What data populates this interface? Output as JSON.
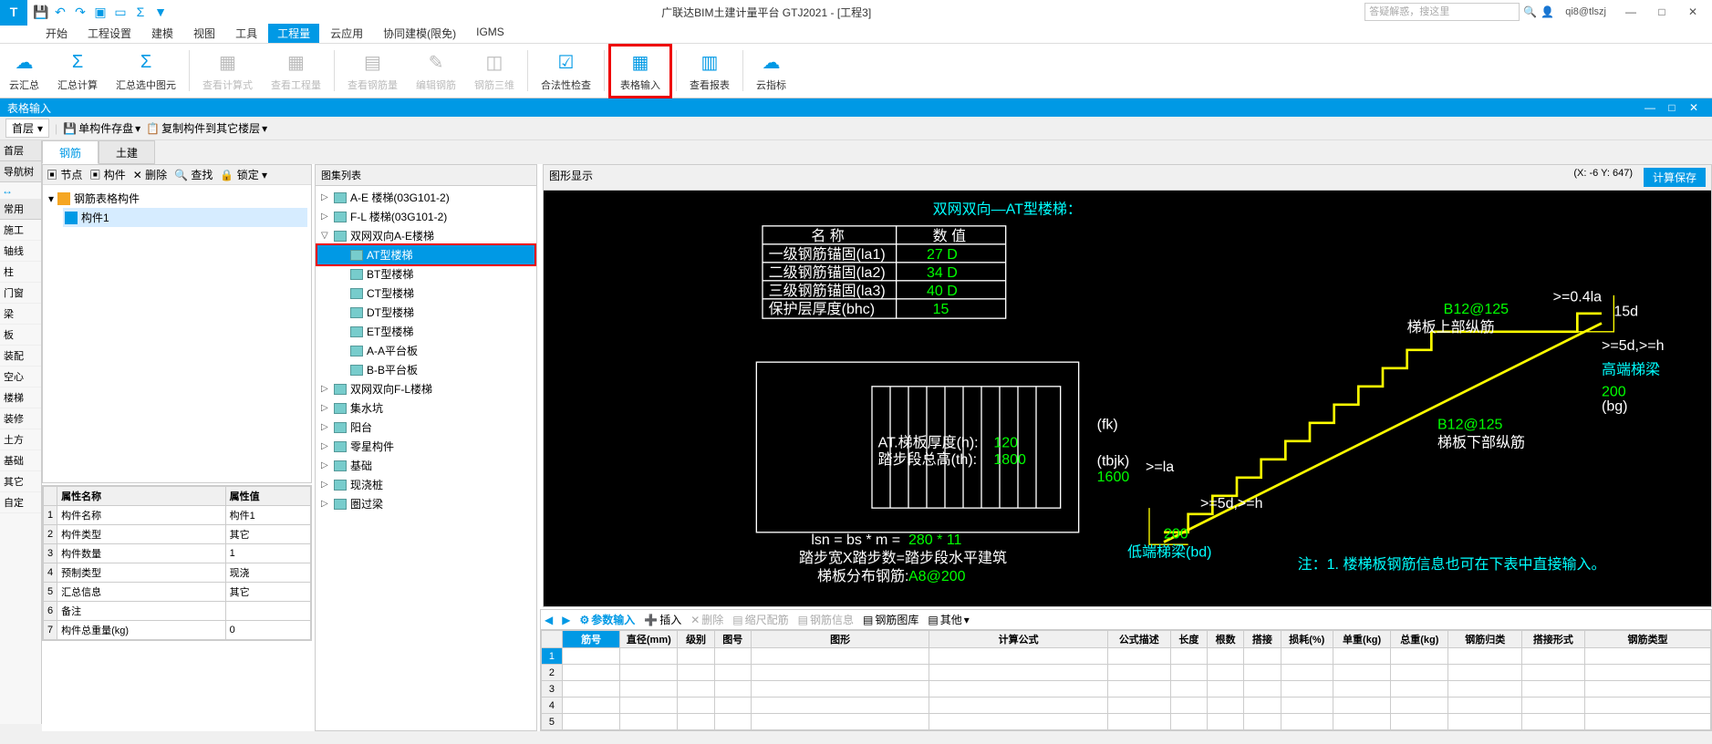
{
  "app": {
    "title": "广联达BIM土建计量平台 GTJ2021 - [工程3]"
  },
  "search_placeholder": "答疑解惑，搜这里",
  "user": "qi8@tlszj",
  "menutabs": [
    "开始",
    "工程设置",
    "建模",
    "视图",
    "工具",
    "工程量",
    "云应用",
    "协同建模(限免)",
    "IGMS"
  ],
  "active_menu_index": 5,
  "ribbon": [
    {
      "label": "云汇总",
      "icon": "☁",
      "disabled": false
    },
    {
      "label": "汇总计算",
      "icon": "Σ",
      "disabled": false
    },
    {
      "label": "汇总选中图元",
      "icon": "Σ",
      "disabled": false
    },
    {
      "sep": true
    },
    {
      "label": "查看计算式",
      "icon": "▦",
      "disabled": true
    },
    {
      "label": "查看工程量",
      "icon": "▦",
      "disabled": true
    },
    {
      "sep": true
    },
    {
      "label": "查看钢筋量",
      "icon": "▤",
      "disabled": true
    },
    {
      "label": "编辑钢筋",
      "icon": "✎",
      "disabled": true
    },
    {
      "label": "钢筋三维",
      "icon": "◫",
      "disabled": true
    },
    {
      "sep": true
    },
    {
      "label": "合法性检查",
      "icon": "☑",
      "disabled": false
    },
    {
      "sep": true
    },
    {
      "label": "表格输入",
      "icon": "▦",
      "disabled": false,
      "hl": true
    },
    {
      "sep": true
    },
    {
      "label": "查看报表",
      "icon": "▥",
      "disabled": false
    },
    {
      "sep": true
    },
    {
      "label": "云指标",
      "icon": "☁",
      "disabled": false
    }
  ],
  "blue_bar": "表格输入",
  "sub_floor": "首层",
  "sub_btn1": "单构件存盘",
  "sub_btn2": "复制构件到其它楼层",
  "left_strip": {
    "hdr1": "首层",
    "hdr2": "导航树",
    "hdr3": "常用",
    "items": [
      "施工",
      "轴线",
      "柱",
      "门窗",
      "梁",
      "板",
      "装配",
      "空心",
      "楼梯",
      "装修",
      "土方",
      "基础",
      "其它",
      "自定"
    ]
  },
  "tabs": [
    "钢筋",
    "土建"
  ],
  "comp_tb": [
    "节点",
    "构件",
    "删除",
    "查找",
    "锁定"
  ],
  "comp_tree": {
    "root": "钢筋表格构件",
    "child": "构件1"
  },
  "gallery_hdr": "图集列表",
  "gallery": [
    {
      "lvl": 0,
      "ex": "▷",
      "label": "A-E 楼梯(03G101-2)"
    },
    {
      "lvl": 0,
      "ex": "▷",
      "label": "F-L 楼梯(03G101-2)"
    },
    {
      "lvl": 0,
      "ex": "▽",
      "label": "双网双向A-E楼梯"
    },
    {
      "lvl": 1,
      "ex": "",
      "label": "AT型楼梯",
      "sel": true,
      "hl": true
    },
    {
      "lvl": 1,
      "ex": "",
      "label": "BT型楼梯"
    },
    {
      "lvl": 1,
      "ex": "",
      "label": "CT型楼梯"
    },
    {
      "lvl": 1,
      "ex": "",
      "label": "DT型楼梯"
    },
    {
      "lvl": 1,
      "ex": "",
      "label": "ET型楼梯"
    },
    {
      "lvl": 1,
      "ex": "",
      "label": "A-A平台板"
    },
    {
      "lvl": 1,
      "ex": "",
      "label": "B-B平台板"
    },
    {
      "lvl": 0,
      "ex": "▷",
      "label": "双网双向F-L楼梯"
    },
    {
      "lvl": 0,
      "ex": "▷",
      "label": "集水坑"
    },
    {
      "lvl": 0,
      "ex": "▷",
      "label": "阳台"
    },
    {
      "lvl": 0,
      "ex": "▷",
      "label": "零星构件"
    },
    {
      "lvl": 0,
      "ex": "▷",
      "label": "基础"
    },
    {
      "lvl": 0,
      "ex": "▷",
      "label": "现浇桩"
    },
    {
      "lvl": 0,
      "ex": "▷",
      "label": "圏过梁"
    }
  ],
  "graphic_hdr": "图形显示",
  "coord": "(X: -6 Y: 647)",
  "calcsave": "计算保存",
  "dwg": {
    "title": "双网双向—AT型楼梯：",
    "tblh_name": "名 称",
    "tblh_val": "数 值",
    "rows": [
      [
        "一级钢筋锚固(la1)",
        "27 D"
      ],
      [
        "二级钢筋锚固(la2)",
        "34 D"
      ],
      [
        "三级钢筋锚固(la3)",
        "40 D"
      ],
      [
        "保护层厚度(bhc)",
        "15"
      ]
    ],
    "h_label": "AT.梯板厚度(h):",
    "h_val": "120",
    "th_label": "踏步段总高(th):",
    "th_val": "1800",
    "fk": "(fk)",
    "tbjk": "(tbjk)",
    "tbjk_val": "1600",
    "lsn": "lsn = bs * m = ",
    "lsn_calc": "280 * 11",
    "bsm": "踏步宽X踏步数=踏步段水平建筑",
    "fbgj": "梯板分布钢筋:",
    "fbgj_val": "A8@200",
    "top_b": "B12@125",
    "top_lbl": "梯板上部纵筋",
    "bot_b": "B12@125",
    "bot_lbl": "梯板下部纵筋",
    "high_beam": "高端梯梁",
    "low_beam": "低端梯梁(bd)",
    "note": "注：1. 楼梯板钢筋信息也可在下表中直接输入。",
    "dim04": ">=0.4la",
    "dim15d": "15d",
    "dim5dh": ">=5d,>=h",
    "dim200": "200",
    "dimbg": "(bg)",
    "dim_la": ">=la"
  },
  "prop_headers": [
    "属性名称",
    "属性值"
  ],
  "props": [
    [
      "1",
      "构件名称",
      "构件1"
    ],
    [
      "2",
      "构件类型",
      "其它"
    ],
    [
      "3",
      "构件数量",
      "1"
    ],
    [
      "4",
      "预制类型",
      "现浇"
    ],
    [
      "5",
      "汇总信息",
      "其它"
    ],
    [
      "6",
      "备注",
      ""
    ],
    [
      "7",
      "构件总重量(kg)",
      "0"
    ]
  ],
  "bottom_btns": [
    "参数输入",
    "插入",
    "删除",
    "缩尺配筋",
    "钢筋信息",
    "钢筋图库",
    "其他"
  ],
  "grid_headers": [
    "",
    "筋号",
    "直径(mm)",
    "级别",
    "图号",
    "图形",
    "计算公式",
    "公式描述",
    "长度",
    "根数",
    "搭接",
    "损耗(%)",
    "单重(kg)",
    "总重(kg)",
    "钢筋归类",
    "搭接形式",
    "钢筋类型"
  ],
  "grid_rows": [
    "1",
    "2",
    "3",
    "4",
    "5"
  ]
}
